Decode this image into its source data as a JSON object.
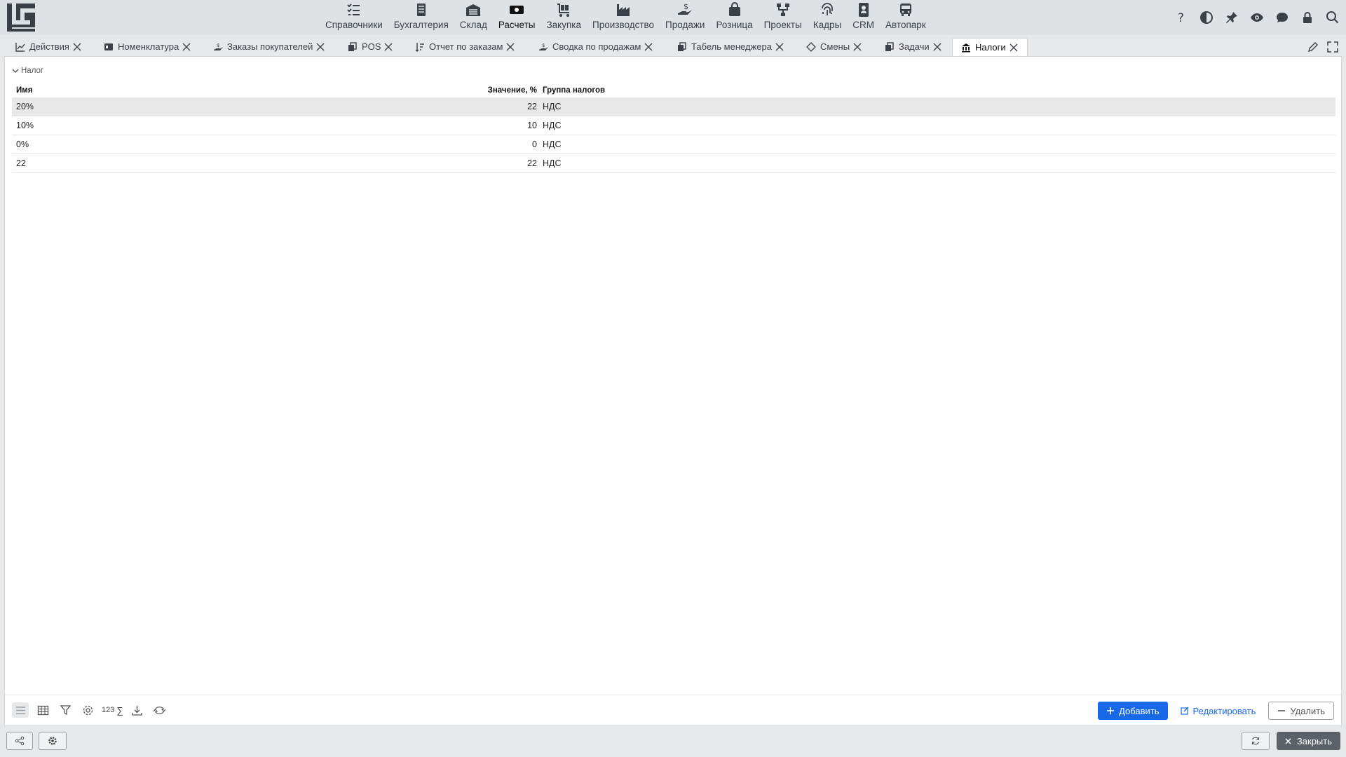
{
  "topmenu": [
    {
      "label": "Справочники",
      "icon": "checklist-icon"
    },
    {
      "label": "Бухгалтерия",
      "icon": "ledger-icon"
    },
    {
      "label": "Склад",
      "icon": "warehouse-icon"
    },
    {
      "label": "Расчеты",
      "icon": "money-icon"
    },
    {
      "label": "Закупка",
      "icon": "cart-icon"
    },
    {
      "label": "Производство",
      "icon": "factory-icon"
    },
    {
      "label": "Продажи",
      "icon": "hand-dollar-icon"
    },
    {
      "label": "Розница",
      "icon": "bag-icon"
    },
    {
      "label": "Проекты",
      "icon": "network-icon"
    },
    {
      "label": "Кадры",
      "icon": "fingerprint-icon"
    },
    {
      "label": "CRM",
      "icon": "contact-card-icon"
    },
    {
      "label": "Автопарк",
      "icon": "bus-icon"
    }
  ],
  "active_menu": "Расчеты",
  "tabs": [
    {
      "label": "Действия",
      "icon": "chart-line-icon"
    },
    {
      "label": "Номенклатура",
      "icon": "id-card-icon"
    },
    {
      "label": "Заказы покупателей",
      "icon": "hand-dollar-icon"
    },
    {
      "label": "POS",
      "icon": "copy-icon"
    },
    {
      "label": "Отчет по заказам",
      "icon": "sort-icon"
    },
    {
      "label": "Сводка по продажам",
      "icon": "hand-dollar-icon"
    },
    {
      "label": "Табель менеджера",
      "icon": "copy-icon"
    },
    {
      "label": "Смены",
      "icon": "diamond-icon"
    },
    {
      "label": "Задачи",
      "icon": "copy-icon"
    },
    {
      "label": "Налоги",
      "icon": "bank-icon"
    }
  ],
  "active_tab": "Налоги",
  "group_title": "Налог",
  "table": {
    "headers": {
      "name": "Имя",
      "value": "Значение, %",
      "group": "Группа налогов"
    },
    "rows": [
      {
        "name": "20%",
        "value": "22",
        "group": "НДС"
      },
      {
        "name": "10%",
        "value": "10",
        "group": "НДС"
      },
      {
        "name": "0%",
        "value": "0",
        "group": "НДС"
      },
      {
        "name": "22",
        "value": "22",
        "group": "НДС"
      }
    ],
    "selected_row": 0
  },
  "footer": {
    "count_label": "123",
    "sum_symbol": "∑",
    "add_label": "Добавить",
    "edit_label": "Редактировать",
    "delete_label": "Удалить"
  },
  "statusbar": {
    "close_label": "Закрыть"
  },
  "colors": {
    "primary": "#1769e8",
    "topbar_bg": "#dfe2e5",
    "selected_row": "#e8e8e8",
    "close_button": "#5c6168"
  }
}
